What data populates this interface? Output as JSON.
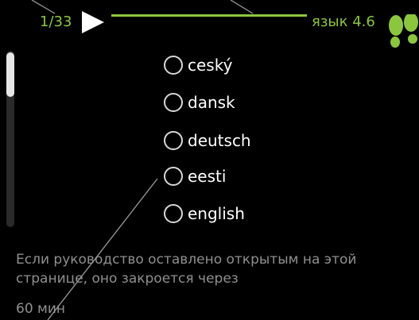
{
  "header": {
    "page_counter": "1/33",
    "menu_title": "язык 4.6"
  },
  "icons": {
    "next": "play-arrow-icon",
    "brand": "footsteps-icon"
  },
  "colors": {
    "accent": "#8cc63f",
    "background": "#000000",
    "text": "#ffffff",
    "muted_text": "#8f8f8f"
  },
  "options": [
    {
      "label": "ceský",
      "selected": false
    },
    {
      "label": "dansk",
      "selected": false
    },
    {
      "label": "deutsch",
      "selected": false
    },
    {
      "label": "eesti",
      "selected": false
    },
    {
      "label": "english",
      "selected": false
    }
  ],
  "notice": {
    "text": "Если руководство оставлено открытым на этой странице, оно закроется через",
    "timeout": "60 мин"
  }
}
